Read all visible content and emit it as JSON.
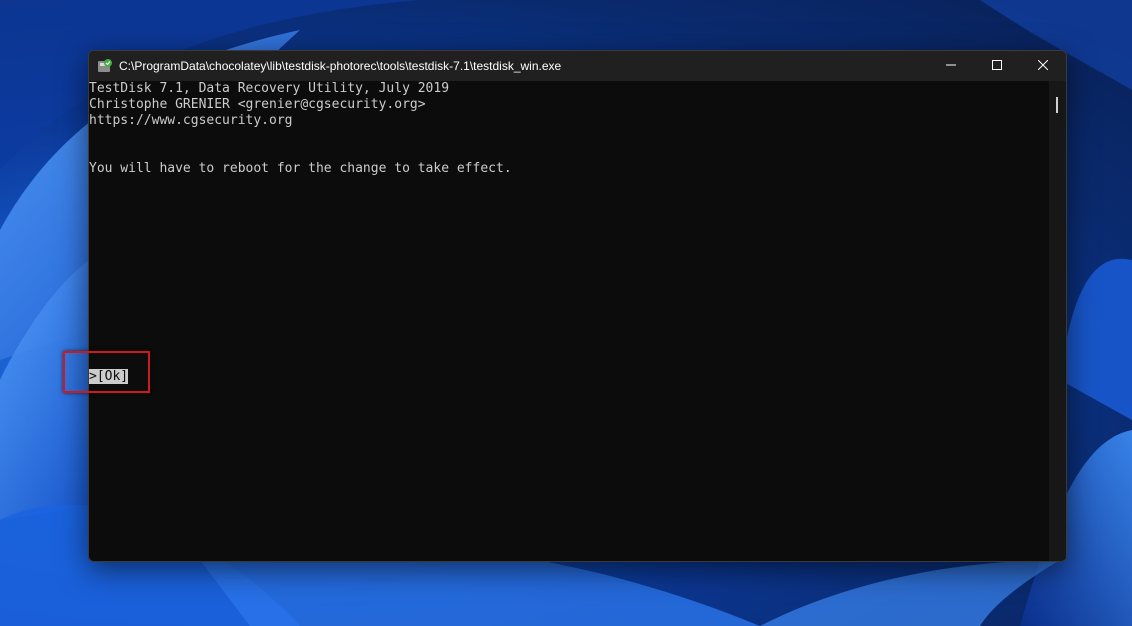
{
  "window": {
    "title": "C:\\ProgramData\\chocolatey\\lib\\testdisk-photorec\\tools\\testdisk-7.1\\testdisk_win.exe",
    "icon": "testdisk-app-icon",
    "controls": {
      "minimize_icon": "minimize-icon",
      "maximize_icon": "maximize-icon",
      "close_icon": "close-icon"
    }
  },
  "console": {
    "header_line1": "TestDisk 7.1, Data Recovery Utility, July 2019",
    "header_line2": "Christophe GRENIER <grenier@cgsecurity.org>",
    "header_line3": "https://www.cgsecurity.org",
    "message": "You will have to reboot for the change to take effect.",
    "ok_prefix": ">",
    "ok_label": "[Ok]"
  },
  "colors": {
    "console_bg": "#0c0c0c",
    "console_text": "#cccccc",
    "titlebar_bg": "#202020",
    "annotation_red": "#d0181f"
  }
}
